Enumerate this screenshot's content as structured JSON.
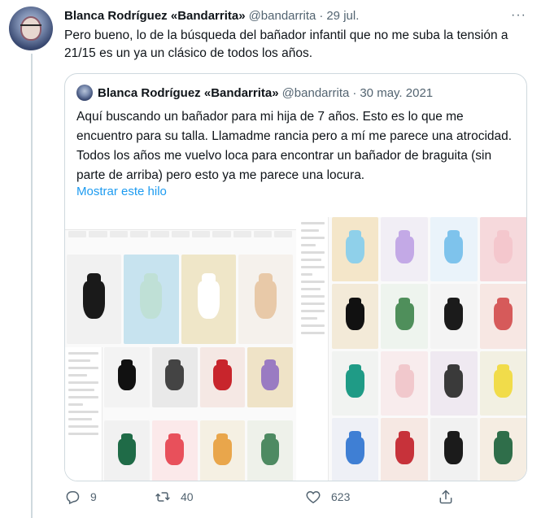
{
  "tweet": {
    "author_name": "Blanca Rodríguez «Bandarrita»",
    "handle": "@bandarrita",
    "separator": "·",
    "date": "29 jul.",
    "more_label": "···",
    "text": "Pero bueno, lo de la búsqueda del bañador infantil que no me suba la tensión a 21/15 es un ya un clásico de todos los años."
  },
  "quoted_tweet": {
    "author_name": "Blanca Rodríguez «Bandarrita»",
    "handle": "@bandarrita",
    "separator": "·",
    "date": "30 may. 2021",
    "text": "Aquí buscando un bañador para mi hija de 7 años. Esto es lo que me encuentro para su talla. Llamadme rancia pero a mí me parece una atrocidad. Todos los años me vuelvo loca para encontrar un bañador de braguita (sin parte de arriba) pero esto ya me parece una locura.",
    "show_thread": "Mostrar este hilo",
    "media_alt": [
      "product-grid-screenshot-left",
      "product-grid-screenshot-right"
    ]
  },
  "actions": {
    "reply_count": "9",
    "retweet_count": "40",
    "like_count": "623",
    "icons": [
      "reply-icon",
      "retweet-icon",
      "like-icon",
      "share-icon"
    ]
  },
  "colors": {
    "accent": "#1d9bf0",
    "secondary_text": "#536471",
    "border": "#cfd9de"
  }
}
